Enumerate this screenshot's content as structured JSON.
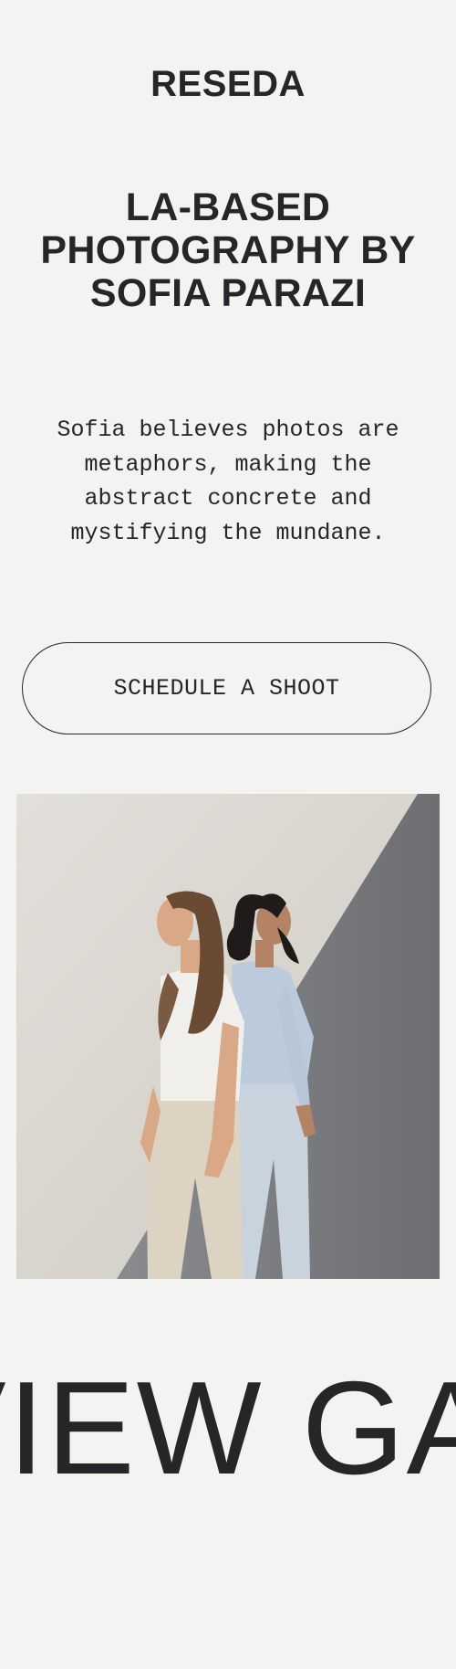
{
  "header": {
    "brand": "RESEDA"
  },
  "hero": {
    "headline": "LA-BASED PHOTOGRAPHY BY SOFIA PARAZI",
    "tagline": "Sofia believes photos are metaphors, making the abstract concrete and mystifying the mundane.",
    "cta_label": "SCHEDULE A SHOOT"
  },
  "photo": {
    "colors": {
      "wall": "#d9d5cf",
      "shadow": "#7d7e82",
      "shirt_white": "#f1efec",
      "pants_cream": "#ddd3c2",
      "shirt_blue": "#bccbdc",
      "pants_blue": "#c9d3de",
      "hair_brown": "#6a4a33",
      "hair_dark": "#1f1b1a",
      "skin_light": "#d9a887",
      "skin_tan": "#b48366"
    }
  },
  "marquee": {
    "text": "VIEW GALLERY"
  }
}
